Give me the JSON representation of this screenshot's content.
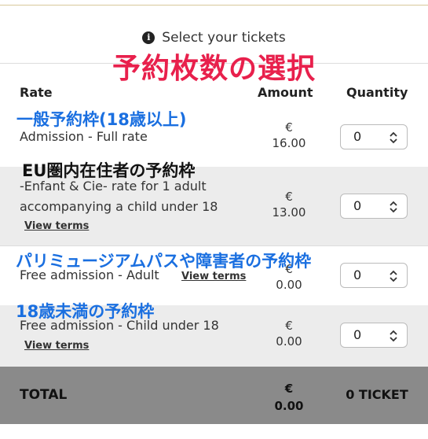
{
  "header": {
    "title": "Select your tickets",
    "annotation": "予約枚数の選択"
  },
  "columns": {
    "rate": "Rate",
    "amount": "Amount",
    "quantity": "Quantity"
  },
  "rows": [
    {
      "annotation": "一般予約枠(18歳以上)",
      "description": "Admission - Full rate",
      "currency": "€",
      "price": "16.00",
      "quantity": "0"
    },
    {
      "annotation": "EU圏内在住者の予約枠",
      "description_line1": "-Enfant & Cie- rate for 1 adult",
      "description_line2": "accompanying a child under 18",
      "terms_label": "View terms",
      "currency": "€",
      "price": "13.00",
      "quantity": "0"
    },
    {
      "annotation": "パリミュージアムパスや障害者の予約枠",
      "description": "Free admission - Adult",
      "terms_label": "View terms",
      "currency": "€",
      "price": "0.00",
      "quantity": "0"
    },
    {
      "annotation": "18歳未満の予約枠",
      "description": "Free admission - Child under 18",
      "terms_label": "View terms",
      "currency": "€",
      "price": "0.00",
      "quantity": "0"
    }
  ],
  "total": {
    "label": "TOTAL",
    "currency": "€",
    "price": "0.00",
    "tickets": "0 TICKET"
  },
  "icons": {
    "info": "info-circle-icon",
    "quantity_arrows": "chevron-up-down-icon"
  },
  "colors": {
    "annotation_red": "#e8204c",
    "annotation_blue": "#1a6fe0",
    "total_bar": "#8a8a8a",
    "shaded_row": "#ececec"
  }
}
